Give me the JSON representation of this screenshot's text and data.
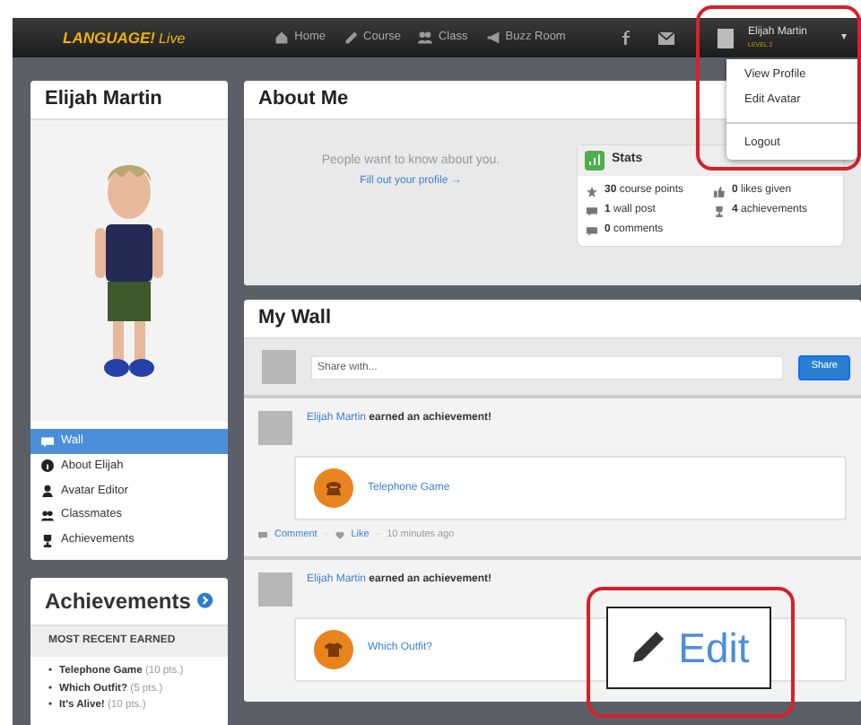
{
  "navbar": {
    "brand": {
      "bold": "LANGUAGE!",
      "light": "Live"
    },
    "links": [
      {
        "label": "Home"
      },
      {
        "label": "Course"
      },
      {
        "label": "Class"
      },
      {
        "label": "Buzz Room"
      }
    ],
    "user": {
      "name": "Elijah Martin",
      "level": "LEVEL 2",
      "caret": "▾"
    }
  },
  "user_menu": {
    "groups": [
      [
        {
          "label": "View Profile"
        },
        {
          "label": "Edit Avatar"
        }
      ],
      [
        {
          "label": "Logout"
        }
      ]
    ]
  },
  "profile_card": {
    "title": "Elijah Martin",
    "nav": [
      {
        "label": "Wall",
        "selected": true
      },
      {
        "label": "About Elijah",
        "selected": false
      },
      {
        "label": "Avatar Editor",
        "selected": false
      },
      {
        "label": "Classmates",
        "selected": false
      },
      {
        "label": "Achievements",
        "selected": false
      }
    ]
  },
  "achievements_card": {
    "title": "Achievements",
    "subtitle": "MOST RECENT EARNED",
    "bullet": "•",
    "items": [
      {
        "name": "Telephone Game",
        "points": "(10 pts.)"
      },
      {
        "name": "Which Outfit?",
        "points": "(5 pts.)"
      },
      {
        "name": "It's Alive!",
        "points": "(10 pts.)"
      }
    ]
  },
  "about_me": {
    "title": "About Me",
    "prompt": "People want to know about you.",
    "link": "Fill out your profile →",
    "stats": {
      "title": "Stats",
      "columns": [
        [
          "**30** course points",
          "**1** wall post",
          "**0** comments"
        ],
        [
          "**0** likes given",
          "**4** achievements"
        ]
      ]
    }
  },
  "wall": {
    "title": "My Wall",
    "share_placeholder": "Share with...",
    "share_button": "Share",
    "posts": [
      {
        "author": "Elijah Martin",
        "action": "earned an achievement!",
        "achievement": "Telephone Game",
        "footer": [
          "Comment",
          "·",
          "Like",
          "·",
          "10 minutes ago"
        ]
      },
      {
        "author": "Elijah Martin",
        "action": "earned an achievement!",
        "achievement": "Which Outfit?"
      }
    ]
  },
  "edit_callout": {
    "label": "Edit"
  }
}
